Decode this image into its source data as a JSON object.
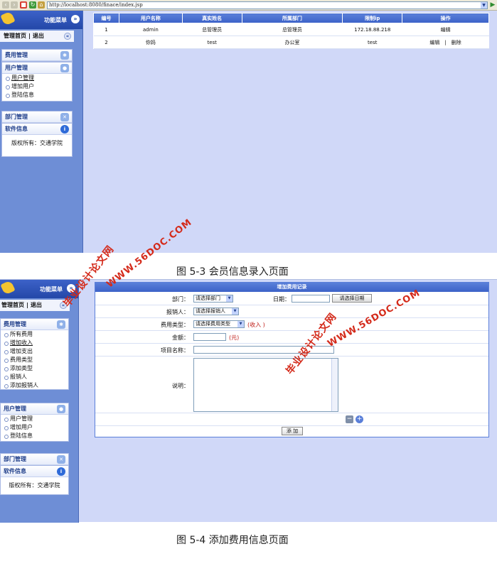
{
  "browser": {
    "url": "http://localhost:8080/finace/index.jsp",
    "go_glyph": "▶"
  },
  "shot1": {
    "sidebar": {
      "title": "功能菜单",
      "nav_home": "管理首页",
      "nav_sep": "|",
      "nav_logout": "退出",
      "expense_panel": "费用管理",
      "user_panel": "用户管理",
      "user_items": [
        "用户管理",
        "增加用户",
        "登陆信息"
      ],
      "dept_panel": "部门管理",
      "software_panel": "软件信息",
      "copyright": "版权所有：交通学院"
    },
    "table": {
      "headers": [
        "编号",
        "用户名称",
        "真实姓名",
        "所属部门",
        "限制ip",
        "操作"
      ],
      "rows": [
        {
          "id": "1",
          "username": "admin",
          "realname": "总管理员",
          "dept": "总管理员",
          "ip": "172.18.88.218",
          "ops": "编辑"
        },
        {
          "id": "2",
          "username": "你妈",
          "realname": "test",
          "dept": "办公室",
          "ip": "test",
          "ops": "编辑　|　删除"
        }
      ]
    },
    "caption": "图 5-3  会员信息录入页面"
  },
  "shot2": {
    "sidebar": {
      "title": "功能菜单",
      "nav_home": "管理首页",
      "nav_sep": "|",
      "nav_logout": "退出",
      "expense_panel": "费用管理",
      "expense_items": [
        "所有费用",
        "增加收入",
        "增加支出",
        "费用类型",
        "添加类型",
        "报销人",
        "添加报销人"
      ],
      "user_panel": "用户管理",
      "user_items": [
        "用户管理",
        "增加用户",
        "登陆信息"
      ],
      "dept_panel": "部门管理",
      "software_panel": "软件信息",
      "copyright": "版权所有：交通学院"
    },
    "form": {
      "title": "增加费用记录",
      "dept_label": "部门：",
      "dept_select": "请选择部门",
      "date_label": "日期：",
      "date_button": "请选择日期",
      "reimburser_label": "报销人：",
      "reimburser_select": "请选择报销人",
      "type_label": "费用类型：",
      "type_select": "请选择费用类型",
      "type_hint": "(收入 )",
      "amount_label": "金额：",
      "amount_hint": "(元)",
      "project_label": "项目名称：",
      "desc_label": "说明：",
      "submit": "添 加"
    },
    "caption": "图 5-4  添加费用信息页面"
  },
  "watermarks": {
    "site": "WWW.56DOC.COM",
    "name": "毕业设计论文网"
  },
  "colors": {
    "accent": "#3c62c8",
    "sidebar": "#6e8ed6",
    "content_bg": "#d0d8f8",
    "watermark": "#d42a1a"
  }
}
